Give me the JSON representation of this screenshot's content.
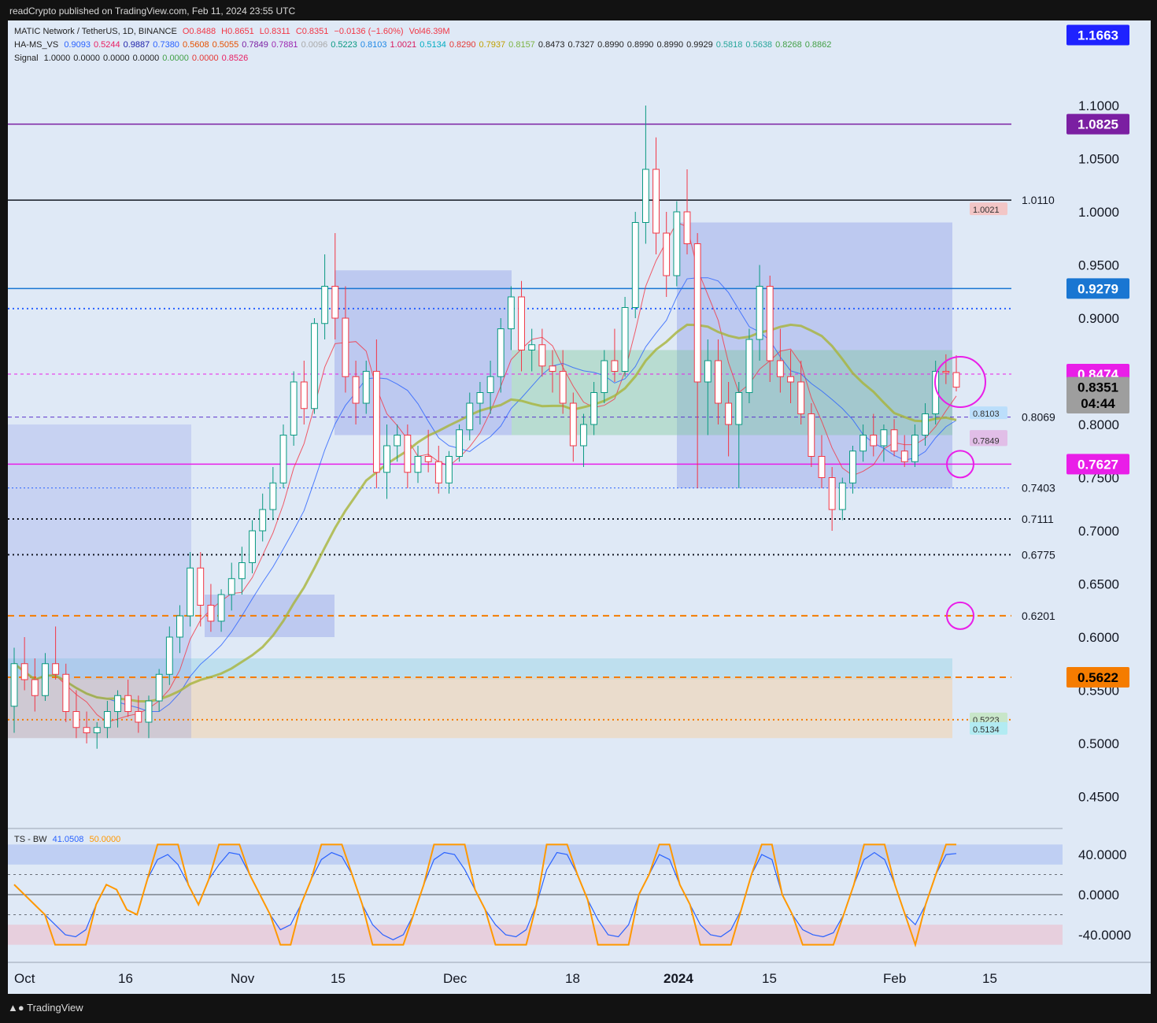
{
  "header": {
    "publisher": "readCrypto published on TradingView.com, Feb 11, 2024 23:55 UTC"
  },
  "legend": {
    "symbol": "MATIC Network / TetherUS, 1D, BINANCE",
    "ohlc": {
      "open": "O0.8488",
      "high": "H0.8651",
      "low": "L0.8311",
      "close": "C0.8351",
      "change": "−0.0136 (−1.60%)",
      "volume": "Vol46.39M"
    },
    "hams_label": "HA-MS_VS",
    "hams_values": [
      "0.9093",
      "0.5244",
      "0.9887",
      "0.7380",
      "0.5608",
      "0.5055",
      "0.7849",
      "0.7881",
      "0.0096",
      "0.5223",
      "0.8103",
      "1.0021",
      "0.5134",
      "0.8290",
      "0.7937",
      "0.8157",
      "0.8473",
      "0.7327",
      "0.8990",
      "0.8990",
      "0.8990",
      "0.9929",
      "0.5818",
      "0.5638",
      "0.8268",
      "0.8862"
    ],
    "hams_colors": [
      "#2962ff",
      "#e91e63",
      "#1e22aa",
      "#2962ff",
      "#e65100",
      "#e65100",
      "#7b1fa2",
      "#9c27b0",
      "#aaaaaa",
      "#089981",
      "#1e88e5",
      "#d81b60",
      "#00acc1",
      "#e53935",
      "#c0a000",
      "#7cb342",
      "#222222",
      "#222222",
      "#222222",
      "#222222",
      "#222222",
      "#222222",
      "#26a69a",
      "#26a69a",
      "#43a047",
      "#43a047"
    ],
    "signal_label": "Signal",
    "signal_values": [
      "1.0000",
      "0.0000",
      "0.0000",
      "0.0000",
      "0.0000",
      "0.0000",
      "0.8526"
    ],
    "signal_colors": [
      "#222222",
      "#222222",
      "#222222",
      "#222222",
      "#43a047",
      "#e53935",
      "#e91e63"
    ]
  },
  "price_badges": [
    {
      "text": "1.1663",
      "bg": "#1e22ff",
      "fg": "#ffffff",
      "value": 1.1663
    },
    {
      "text": "1.0825",
      "bg": "#7b1fa2",
      "fg": "#ffffff",
      "value": 1.0825
    },
    {
      "text": "0.9279",
      "bg": "#1976d2",
      "fg": "#ffffff",
      "value": 0.9279
    },
    {
      "text": "0.8474",
      "bg": "#e91ee8",
      "fg": "#ffffff",
      "value": 0.8474
    },
    {
      "text": "0.8351",
      "bg": "#9e9e9e",
      "fg": "#000000",
      "value": 0.8351
    },
    {
      "text": "04:44",
      "bg": "#9e9e9e",
      "fg": "#000000",
      "value": 0.82
    },
    {
      "text": "0.7627",
      "bg": "#e91ee8",
      "fg": "#ffffff",
      "value": 0.7627
    },
    {
      "text": "0.5622",
      "bg": "#f57c00",
      "fg": "#000000",
      "value": 0.5622
    }
  ],
  "price_axis_ticks": [
    "1.1000",
    "1.0500",
    "1.0000",
    "0.9500",
    "0.9000",
    "0.8000",
    "0.7500",
    "0.7000",
    "0.6500",
    "0.6000",
    "0.5500",
    "0.5000",
    "0.4500"
  ],
  "level_labels": [
    {
      "text": "1.0110",
      "value": 1.011
    },
    {
      "text": "0.8069",
      "value": 0.8069
    },
    {
      "text": "0.7403",
      "value": 0.7403
    },
    {
      "text": "0.7111",
      "value": 0.7111
    },
    {
      "text": "0.6775",
      "value": 0.6775
    },
    {
      "text": "0.6201",
      "value": 0.6201
    }
  ],
  "tag_labels": [
    {
      "text": "1.0021",
      "value": 1.0021,
      "color": "#f2c6c6"
    },
    {
      "text": "0.8103",
      "value": 0.8103,
      "color": "#bbdefb"
    },
    {
      "text": "0.7881",
      "value": 0.7881,
      "color": "#e1bee7"
    },
    {
      "text": "0.7849",
      "value": 0.7849,
      "color": "#e1bee7"
    },
    {
      "text": "0.5223",
      "value": 0.5223,
      "color": "#c8e6c9"
    },
    {
      "text": "0.5134",
      "value": 0.5134,
      "color": "#b2ebf2"
    }
  ],
  "date_axis": [
    "Oct",
    "16",
    "Nov",
    "15",
    "Dec",
    "18",
    "2024",
    "15",
    "Feb",
    "15"
  ],
  "oscillator": {
    "label": "TS - BW",
    "value1": "41.0508",
    "value2": "50.0000",
    "ticks": [
      "40.0000",
      "0.0000",
      "-40.0000"
    ]
  },
  "footer": {
    "logo_text": "TradingView"
  },
  "colors": {
    "up": "#089981",
    "down": "#f23645",
    "chart_bg": "#dfe9f6"
  },
  "chart_data": {
    "type": "candlestick",
    "title": "MATIC Network / TetherUS, 1D, BINANCE",
    "ylim": [
      0.42,
      1.18
    ],
    "grid": false,
    "candles": [
      [
        0.535,
        0.59,
        0.51,
        0.575
      ],
      [
        0.575,
        0.6,
        0.55,
        0.56
      ],
      [
        0.56,
        0.58,
        0.53,
        0.545
      ],
      [
        0.545,
        0.585,
        0.54,
        0.575
      ],
      [
        0.575,
        0.61,
        0.56,
        0.565
      ],
      [
        0.565,
        0.575,
        0.52,
        0.53
      ],
      [
        0.53,
        0.55,
        0.505,
        0.515
      ],
      [
        0.515,
        0.53,
        0.5,
        0.51
      ],
      [
        0.51,
        0.52,
        0.495,
        0.515
      ],
      [
        0.515,
        0.54,
        0.505,
        0.53
      ],
      [
        0.53,
        0.55,
        0.515,
        0.545
      ],
      [
        0.545,
        0.56,
        0.525,
        0.53
      ],
      [
        0.53,
        0.545,
        0.51,
        0.52
      ],
      [
        0.52,
        0.545,
        0.505,
        0.54
      ],
      [
        0.54,
        0.57,
        0.53,
        0.565
      ],
      [
        0.565,
        0.61,
        0.555,
        0.6
      ],
      [
        0.6,
        0.63,
        0.585,
        0.62
      ],
      [
        0.62,
        0.68,
        0.61,
        0.665
      ],
      [
        0.665,
        0.68,
        0.61,
        0.63
      ],
      [
        0.63,
        0.65,
        0.605,
        0.615
      ],
      [
        0.615,
        0.645,
        0.605,
        0.64
      ],
      [
        0.64,
        0.67,
        0.625,
        0.655
      ],
      [
        0.655,
        0.685,
        0.64,
        0.67
      ],
      [
        0.67,
        0.71,
        0.66,
        0.7
      ],
      [
        0.7,
        0.735,
        0.69,
        0.72
      ],
      [
        0.72,
        0.76,
        0.71,
        0.745
      ],
      [
        0.745,
        0.8,
        0.74,
        0.79
      ],
      [
        0.79,
        0.85,
        0.78,
        0.84
      ],
      [
        0.84,
        0.86,
        0.8,
        0.815
      ],
      [
        0.815,
        0.9,
        0.81,
        0.895
      ],
      [
        0.895,
        0.96,
        0.88,
        0.93
      ],
      [
        0.93,
        0.98,
        0.88,
        0.9
      ],
      [
        0.9,
        0.93,
        0.83,
        0.845
      ],
      [
        0.845,
        0.86,
        0.8,
        0.82
      ],
      [
        0.82,
        0.86,
        0.81,
        0.85
      ],
      [
        0.85,
        0.88,
        0.74,
        0.755
      ],
      [
        0.755,
        0.8,
        0.73,
        0.78
      ],
      [
        0.78,
        0.8,
        0.765,
        0.79
      ],
      [
        0.79,
        0.8,
        0.74,
        0.755
      ],
      [
        0.755,
        0.78,
        0.745,
        0.77
      ],
      [
        0.77,
        0.795,
        0.755,
        0.765
      ],
      [
        0.765,
        0.78,
        0.735,
        0.745
      ],
      [
        0.745,
        0.775,
        0.735,
        0.77
      ],
      [
        0.77,
        0.8,
        0.765,
        0.795
      ],
      [
        0.795,
        0.83,
        0.785,
        0.82
      ],
      [
        0.82,
        0.84,
        0.8,
        0.83
      ],
      [
        0.83,
        0.86,
        0.81,
        0.845
      ],
      [
        0.845,
        0.9,
        0.83,
        0.89
      ],
      [
        0.89,
        0.93,
        0.87,
        0.92
      ],
      [
        0.92,
        0.935,
        0.85,
        0.87
      ],
      [
        0.87,
        0.89,
        0.85,
        0.875
      ],
      [
        0.875,
        0.89,
        0.845,
        0.855
      ],
      [
        0.855,
        0.87,
        0.83,
        0.85
      ],
      [
        0.85,
        0.87,
        0.81,
        0.82
      ],
      [
        0.82,
        0.83,
        0.765,
        0.78
      ],
      [
        0.78,
        0.81,
        0.76,
        0.8
      ],
      [
        0.8,
        0.84,
        0.79,
        0.83
      ],
      [
        0.83,
        0.87,
        0.82,
        0.86
      ],
      [
        0.86,
        0.89,
        0.84,
        0.85
      ],
      [
        0.85,
        0.92,
        0.845,
        0.91
      ],
      [
        0.91,
        1.0,
        0.9,
        0.99
      ],
      [
        0.99,
        1.1,
        0.97,
        1.04
      ],
      [
        1.04,
        1.07,
        0.96,
        0.98
      ],
      [
        0.98,
        1.0,
        0.92,
        0.94
      ],
      [
        0.94,
        1.01,
        0.93,
        1.0
      ],
      [
        1.0,
        1.04,
        0.96,
        0.97
      ],
      [
        0.97,
        0.98,
        0.74,
        0.84
      ],
      [
        0.84,
        0.88,
        0.79,
        0.86
      ],
      [
        0.86,
        0.88,
        0.8,
        0.82
      ],
      [
        0.82,
        0.84,
        0.77,
        0.8
      ],
      [
        0.8,
        0.84,
        0.74,
        0.83
      ],
      [
        0.83,
        0.89,
        0.82,
        0.88
      ],
      [
        0.88,
        0.95,
        0.86,
        0.93
      ],
      [
        0.93,
        0.94,
        0.84,
        0.86
      ],
      [
        0.86,
        0.89,
        0.83,
        0.845
      ],
      [
        0.845,
        0.87,
        0.82,
        0.84
      ],
      [
        0.84,
        0.86,
        0.8,
        0.81
      ],
      [
        0.81,
        0.82,
        0.76,
        0.77
      ],
      [
        0.77,
        0.79,
        0.74,
        0.75
      ],
      [
        0.75,
        0.76,
        0.7,
        0.72
      ],
      [
        0.72,
        0.75,
        0.71,
        0.745
      ],
      [
        0.745,
        0.78,
        0.735,
        0.775
      ],
      [
        0.775,
        0.8,
        0.765,
        0.79
      ],
      [
        0.79,
        0.81,
        0.77,
        0.78
      ],
      [
        0.78,
        0.8,
        0.765,
        0.795
      ],
      [
        0.795,
        0.805,
        0.77,
        0.775
      ],
      [
        0.775,
        0.79,
        0.76,
        0.765
      ],
      [
        0.765,
        0.8,
        0.76,
        0.79
      ],
      [
        0.79,
        0.82,
        0.78,
        0.81
      ],
      [
        0.81,
        0.86,
        0.8,
        0.85
      ],
      [
        0.85,
        0.866,
        0.838,
        0.8488
      ],
      [
        0.8488,
        0.8651,
        0.8311,
        0.8351
      ]
    ],
    "oscillator_line": [
      10,
      0,
      -10,
      -20,
      -30,
      -40,
      -42,
      -35,
      -10,
      10,
      5,
      -15,
      -20,
      15,
      35,
      40,
      30,
      10,
      -10,
      15,
      30,
      42,
      40,
      20,
      0,
      -20,
      -35,
      -30,
      -10,
      15,
      35,
      42,
      38,
      20,
      -10,
      -30,
      -40,
      -45,
      -40,
      -20,
      10,
      35,
      42,
      40,
      25,
      5,
      -15,
      -30,
      -40,
      -42,
      -35,
      -10,
      25,
      42,
      40,
      20,
      -5,
      -25,
      -40,
      -42,
      -30,
      0,
      20,
      40,
      35,
      10,
      -10,
      -30,
      -40,
      -42,
      -35,
      -15,
      20,
      40,
      35,
      0,
      -20,
      -35,
      -40,
      -42,
      -38,
      -20,
      10,
      35,
      42,
      35,
      10,
      -20,
      -30,
      -10,
      20,
      40,
      41
    ]
  }
}
